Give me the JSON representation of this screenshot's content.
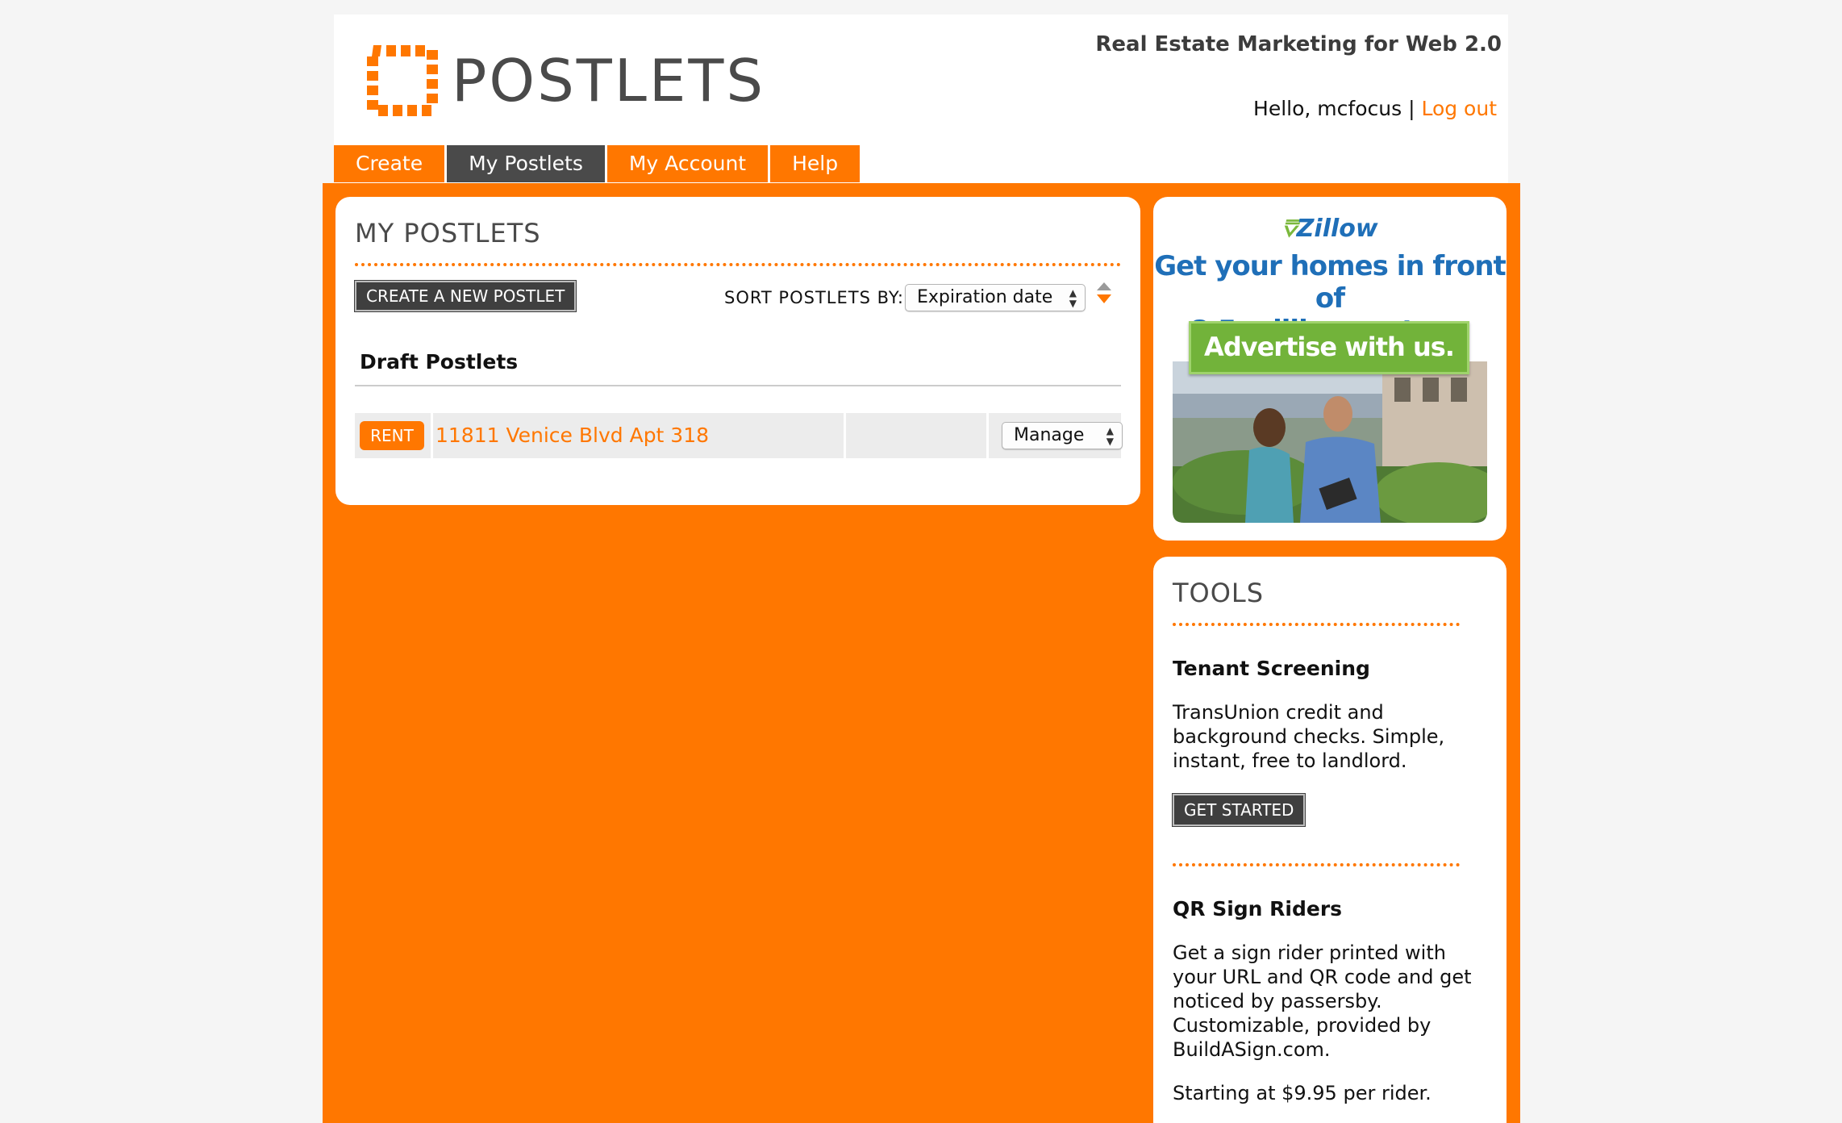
{
  "header": {
    "logo_text": "POSTLETS",
    "tagline": "Real Estate Marketing for Web 2.0",
    "greeting": "Hello, mcfocus",
    "separator": "|",
    "logout_label": "Log out",
    "brand_color": "#ff7700"
  },
  "nav": {
    "tabs": [
      {
        "label": "Create",
        "active": false
      },
      {
        "label": "My Postlets",
        "active": true
      },
      {
        "label": "My Account",
        "active": false
      },
      {
        "label": "Help",
        "active": false
      }
    ]
  },
  "main": {
    "title": "MY POSTLETS",
    "create_button": "CREATE A NEW POSTLET",
    "sort_label": "SORT POSTLETS BY:",
    "sort_value": "Expiration date",
    "section_title": "Draft Postlets",
    "listings": [
      {
        "type_badge": "RENT",
        "address": "11811 Venice Blvd Apt 318",
        "action": "Manage"
      }
    ]
  },
  "ad": {
    "brand": "Zillow",
    "headline_line1": "Get your homes in front of",
    "headline_line2": "8.5 million renters.",
    "cta": "Advertise with us."
  },
  "tools": {
    "title": "TOOLS",
    "items": [
      {
        "heading": "Tenant Screening",
        "body": "TransUnion credit and background checks. Simple, instant, free to landlord.",
        "button": "GET STARTED"
      },
      {
        "heading": "QR Sign Riders",
        "body": "Get a sign rider printed with your URL and QR code and get noticed by passersby. Customizable, provided by BuildASign.com.",
        "price": "Starting at $9.95 per rider."
      }
    ]
  }
}
